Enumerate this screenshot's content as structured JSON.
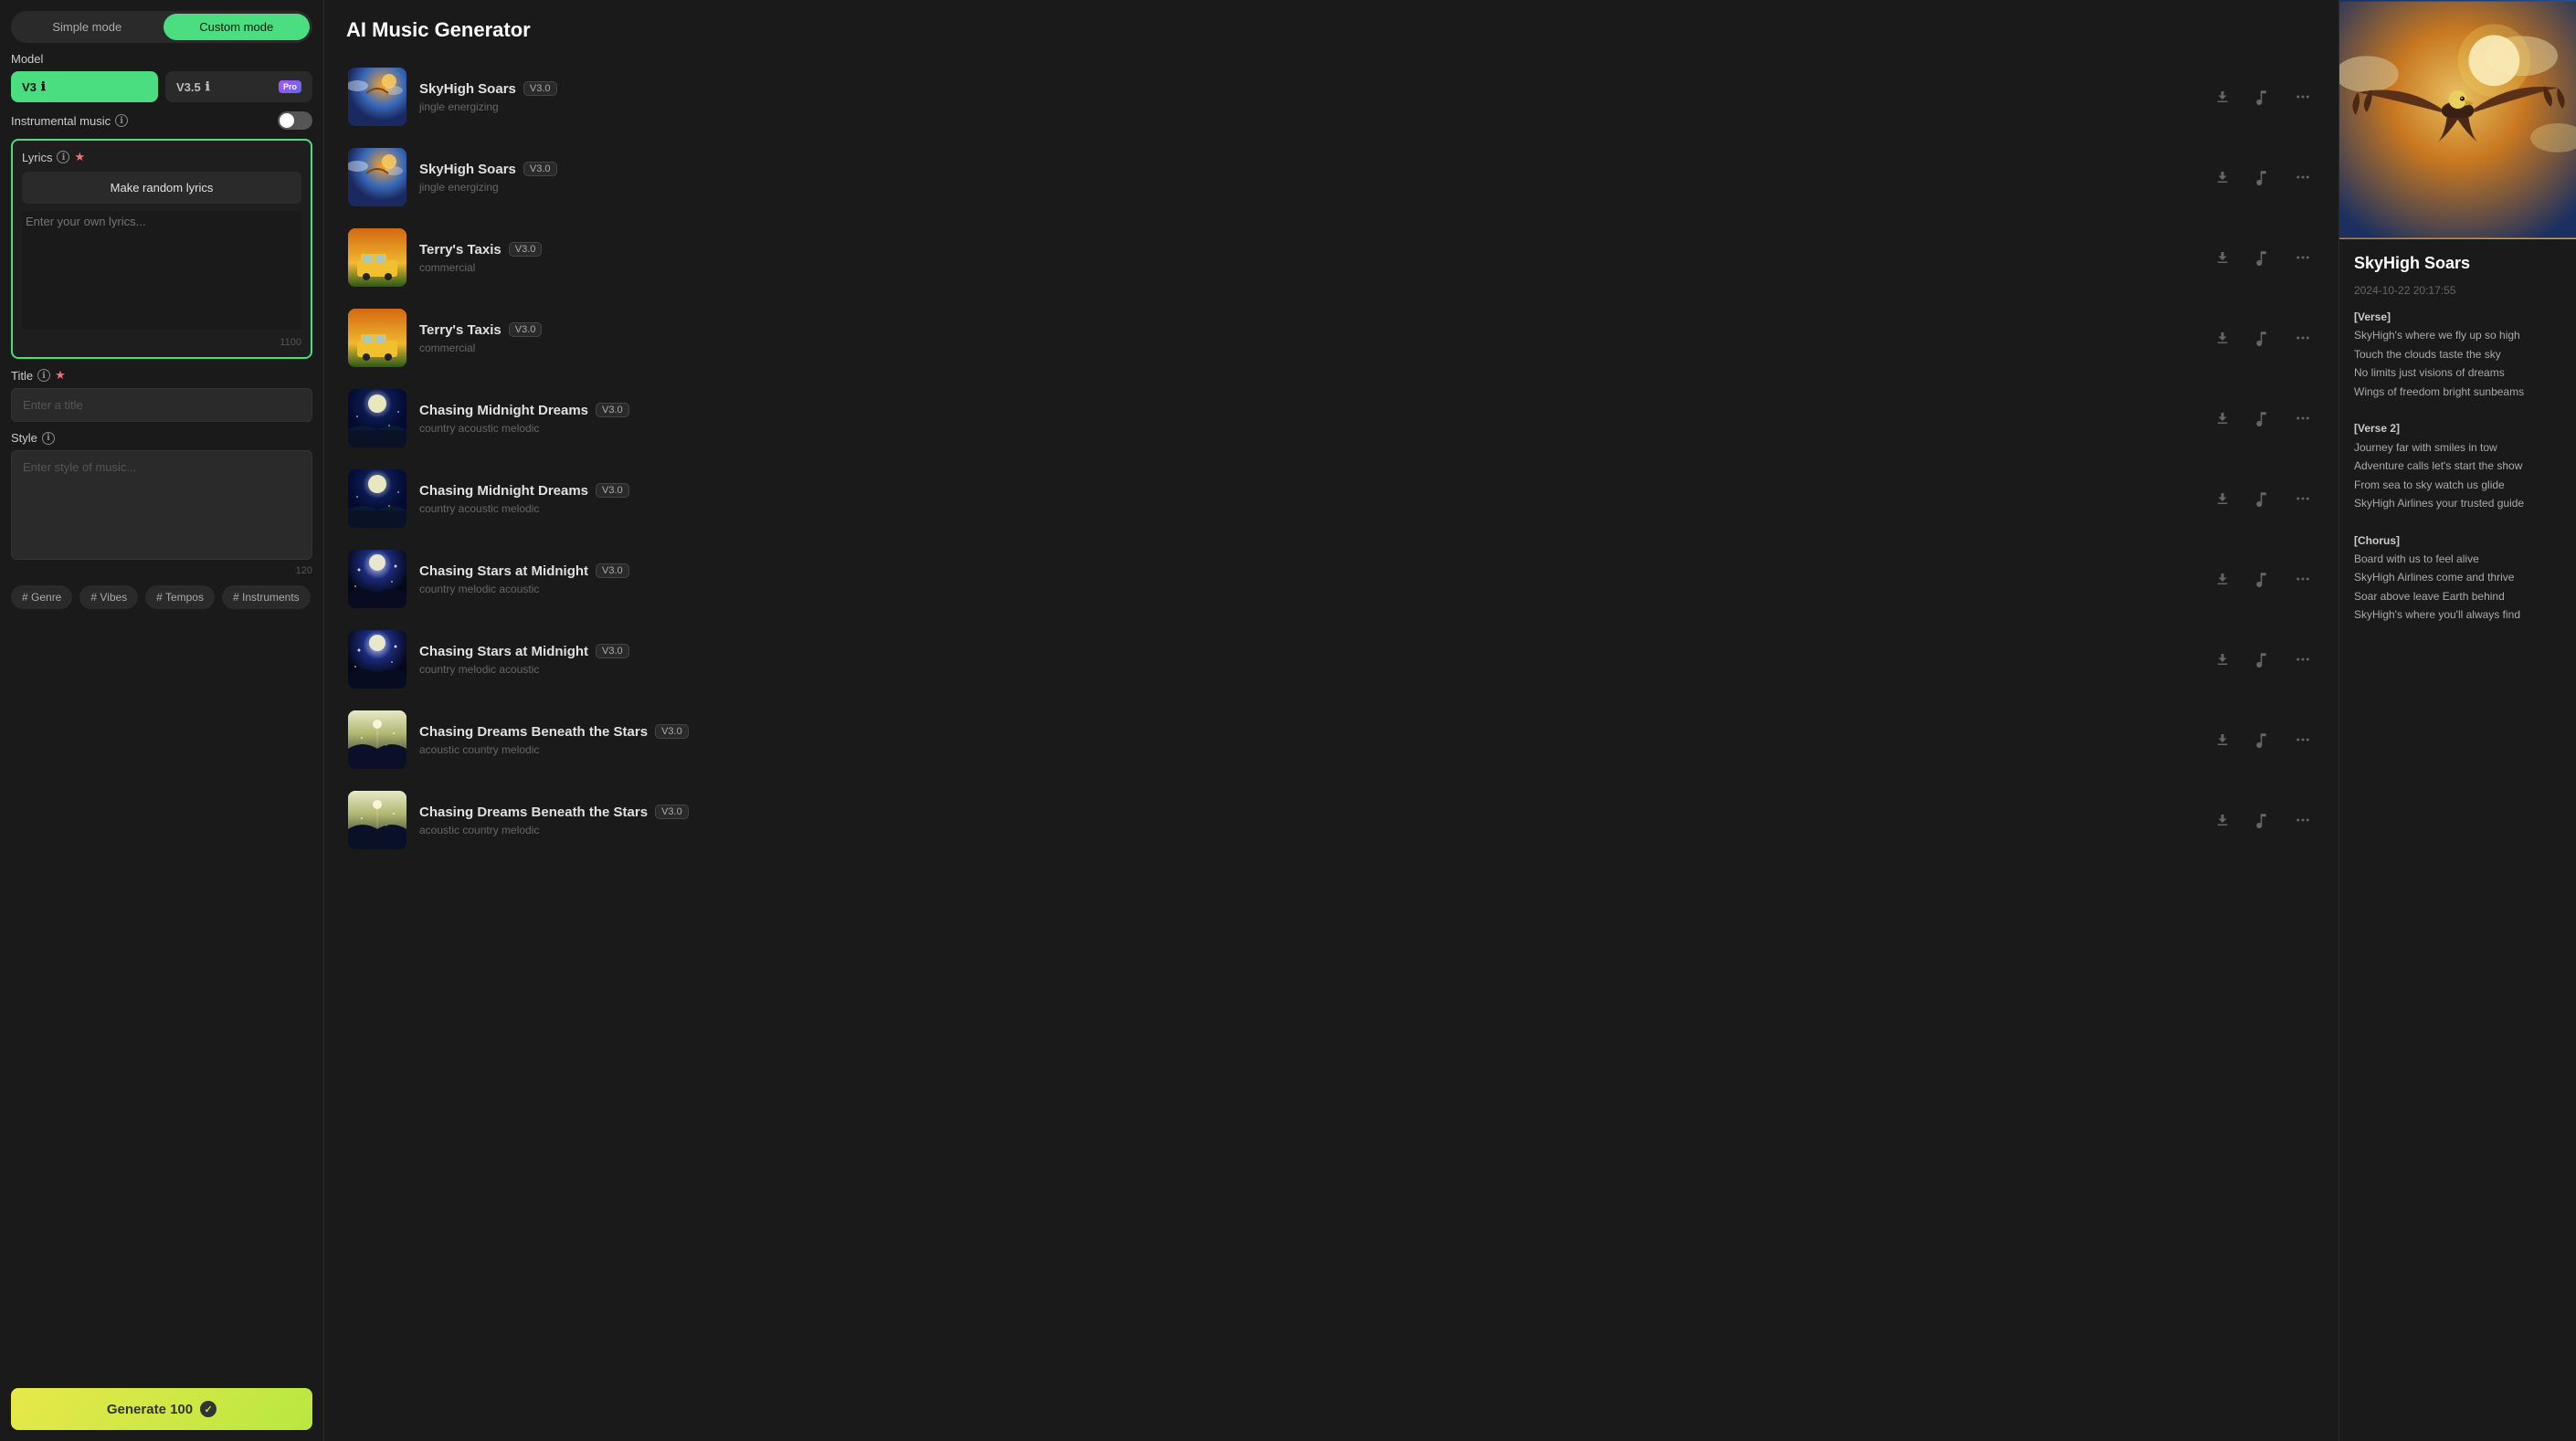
{
  "app": {
    "title": "AI Music Generator"
  },
  "left_panel": {
    "mode_simple": "Simple mode",
    "mode_custom": "Custom mode",
    "model_label": "Model",
    "v3_label": "V3",
    "v35_label": "V3.5",
    "pro_badge": "Pro",
    "instrumental_label": "Instrumental music",
    "lyrics_label": "Lyrics",
    "make_random_label": "Make random lyrics",
    "lyrics_placeholder": "Enter your own lyrics...",
    "lyrics_char_count": "1100",
    "title_label": "Title",
    "title_placeholder": "Enter a title",
    "style_label": "Style",
    "style_placeholder": "Enter style of music...",
    "style_char_count": "120",
    "tag_genre": "# Genre",
    "tag_vibes": "# Vibes",
    "tag_tempos": "# Tempos",
    "tag_instruments": "# Instruments",
    "generate_label": "Generate 100"
  },
  "songs": [
    {
      "id": 1,
      "name": "SkyHigh Soars",
      "version": "V3.0",
      "style": "jingle energizing",
      "thumb_class": "thumb-sky-1"
    },
    {
      "id": 2,
      "name": "SkyHigh Soars",
      "version": "V3.0",
      "style": "jingle energizing",
      "thumb_class": "thumb-sky-1"
    },
    {
      "id": 3,
      "name": "Terry's Taxis",
      "version": "V3.0",
      "style": "commercial",
      "thumb_class": "thumb-taxi-1"
    },
    {
      "id": 4,
      "name": "Terry's Taxis",
      "version": "V3.0",
      "style": "commercial",
      "thumb_class": "thumb-taxi-1"
    },
    {
      "id": 5,
      "name": "Chasing Midnight Dreams",
      "version": "V3.0",
      "style": "country acoustic melodic",
      "thumb_class": "thumb-night-1"
    },
    {
      "id": 6,
      "name": "Chasing Midnight Dreams",
      "version": "V3.0",
      "style": "country acoustic melodic",
      "thumb_class": "thumb-night-1"
    },
    {
      "id": 7,
      "name": "Chasing Stars at Midnight",
      "version": "V3.0",
      "style": "country melodic acoustic",
      "thumb_class": "thumb-stars-1"
    },
    {
      "id": 8,
      "name": "Chasing Stars at Midnight",
      "version": "V3.0",
      "style": "country melodic acoustic",
      "thumb_class": "thumb-stars-1"
    },
    {
      "id": 9,
      "name": "Chasing Dreams Beneath the Stars",
      "version": "V3.0",
      "style": "acoustic country melodic",
      "thumb_class": "thumb-dreams-1"
    },
    {
      "id": 10,
      "name": "Chasing Dreams Beneath the Stars",
      "version": "V3.0",
      "style": "acoustic country melodic",
      "thumb_class": "thumb-dreams-1"
    }
  ],
  "right_panel": {
    "song_title": "SkyHigh Soars",
    "song_date": "2024-10-22 20:17:55",
    "lyrics": "[Verse]\nSkyHigh's where we fly up so high\nTouch the clouds taste the sky\nNo limits just visions of dreams\nWings of freedom bright sunbeams\n\n[Verse 2]\nJourney far with smiles in tow\nAdventure calls let's start the show\nFrom sea to sky watch us glide\nSkyHigh Airlines your trusted guide\n\n[Chorus]\nBoard with us to feel alive\nSkyHigh Airlines come and thrive\nSoar above leave Earth behind\nSkyHigh's where you'll always find"
  }
}
